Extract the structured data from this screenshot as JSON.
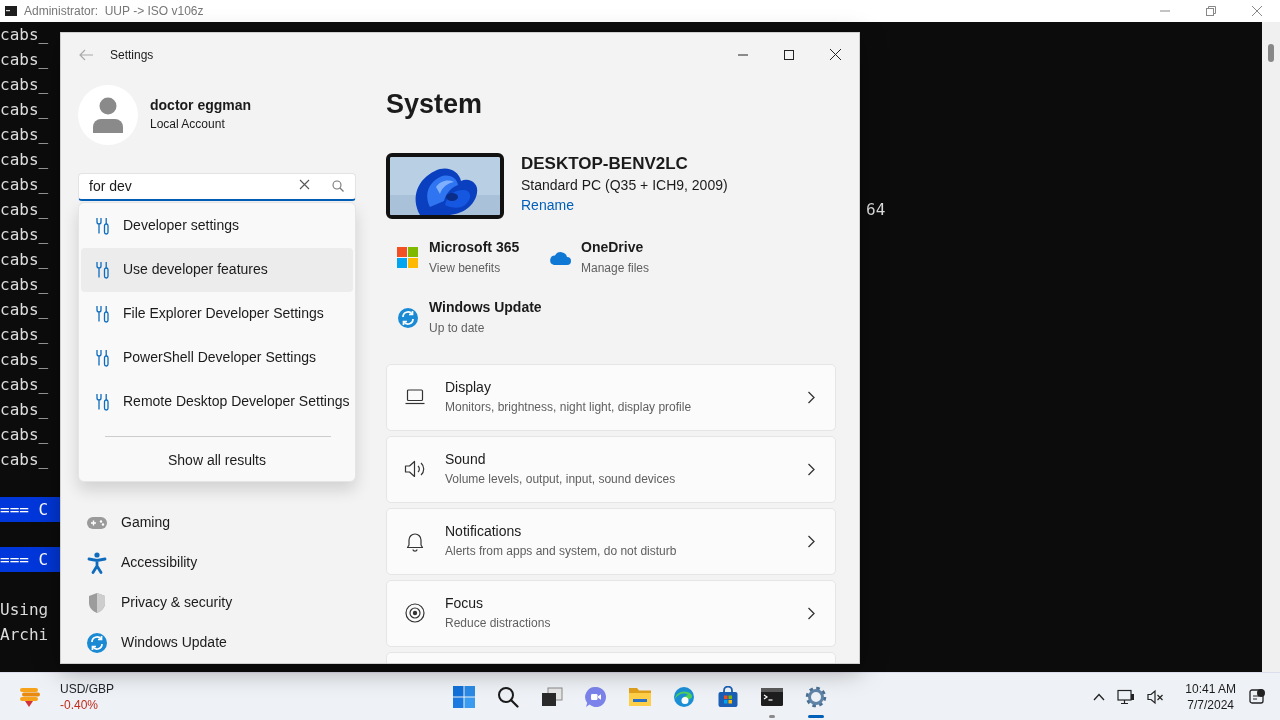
{
  "console": {
    "title": "Administrator:  UUP -> ISO v106z",
    "lines": [
      {
        "kind": "text",
        "text": "cabs_",
        "highlighted": false
      },
      {
        "kind": "text",
        "text": "cabs_",
        "highlighted": false
      },
      {
        "kind": "text",
        "text": "cabs_",
        "highlighted": false
      },
      {
        "kind": "text",
        "text": "cabs_",
        "highlighted": false
      },
      {
        "kind": "text",
        "text": "cabs_",
        "highlighted": false
      },
      {
        "kind": "text",
        "text": "cabs_",
        "highlighted": false
      },
      {
        "kind": "text",
        "text": "cabs_",
        "highlighted": false
      },
      {
        "kind": "text",
        "text": "cabs_",
        "tail": "64",
        "highlighted": false
      },
      {
        "kind": "text",
        "text": "cabs_",
        "highlighted": false
      },
      {
        "kind": "text",
        "text": "cabs_",
        "highlighted": false
      },
      {
        "kind": "text",
        "text": "cabs_",
        "highlighted": false
      },
      {
        "kind": "text",
        "text": "cabs_",
        "highlighted": false
      },
      {
        "kind": "text",
        "text": "cabs_",
        "highlighted": false
      },
      {
        "kind": "text",
        "text": "cabs_",
        "highlighted": false
      },
      {
        "kind": "text",
        "text": "cabs_",
        "highlighted": false
      },
      {
        "kind": "text",
        "text": "cabs_",
        "highlighted": false
      },
      {
        "kind": "text",
        "text": "cabs_",
        "highlighted": false
      },
      {
        "kind": "text",
        "text": "cabs_",
        "highlighted": false
      },
      {
        "kind": "blank"
      },
      {
        "kind": "text",
        "text": "=== C",
        "highlighted": true
      },
      {
        "kind": "blank"
      },
      {
        "kind": "text",
        "text": "=== C",
        "highlighted": true
      },
      {
        "kind": "blank"
      },
      {
        "kind": "text",
        "text": "Using",
        "highlighted": false
      },
      {
        "kind": "text",
        "text": "Archi",
        "highlighted": false
      }
    ]
  },
  "settings": {
    "title": "Settings",
    "account": {
      "name": "doctor eggman",
      "type": "Local Account"
    },
    "search": {
      "value": "for dev"
    },
    "suggestions": [
      {
        "label": "Developer settings",
        "hovered": false
      },
      {
        "label": "Use developer features",
        "hovered": true
      },
      {
        "label": "File Explorer Developer Settings",
        "hovered": false
      },
      {
        "label": "PowerShell Developer Settings",
        "hovered": false
      },
      {
        "label": "Remote Desktop Developer Settings",
        "hovered": false
      }
    ],
    "show_all": "Show all results",
    "nav": [
      {
        "kind": "gaming",
        "label": "Gaming"
      },
      {
        "kind": "accessibility",
        "label": "Accessibility"
      },
      {
        "kind": "privacy",
        "label": "Privacy & security"
      },
      {
        "kind": "update",
        "label": "Windows Update"
      }
    ],
    "heading": "System",
    "device": {
      "name": "DESKTOP-BENV2LC",
      "model": "Standard PC (Q35 + ICH9, 2009)",
      "rename": "Rename"
    },
    "tiles": [
      {
        "kind": "office",
        "title": "Microsoft 365",
        "subtitle": "View benefits"
      },
      {
        "kind": "cloud",
        "title": "OneDrive",
        "subtitle": "Manage files"
      },
      {
        "kind": "update",
        "title": "Windows Update",
        "subtitle": "Up to date"
      }
    ],
    "cards": [
      {
        "kind": "display",
        "title": "Display",
        "subtitle": "Monitors, brightness, night light, display profile"
      },
      {
        "kind": "sound",
        "title": "Sound",
        "subtitle": "Volume levels, output, input, sound devices"
      },
      {
        "kind": "notifications",
        "title": "Notifications",
        "subtitle": "Alerts from apps and system, do not disturb"
      },
      {
        "kind": "focus",
        "title": "Focus",
        "subtitle": "Reduce distractions"
      }
    ]
  },
  "taskbar": {
    "widget": {
      "title": "USD/GBP",
      "change": "-0.40%"
    },
    "apps": [
      {
        "kind": "start",
        "running": false,
        "selected": false
      },
      {
        "kind": "search",
        "running": false,
        "selected": false
      },
      {
        "kind": "taskview",
        "running": false,
        "selected": false
      },
      {
        "kind": "chat",
        "running": false,
        "selected": false
      },
      {
        "kind": "folder",
        "running": false,
        "selected": false
      },
      {
        "kind": "browser",
        "running": false,
        "selected": false
      },
      {
        "kind": "store",
        "running": false,
        "selected": false
      },
      {
        "kind": "terminal",
        "running": true,
        "selected": false
      },
      {
        "kind": "settings",
        "running": true,
        "selected": true
      }
    ],
    "clock": {
      "time": "10:41 AM",
      "date": "7/7/2024"
    }
  }
}
